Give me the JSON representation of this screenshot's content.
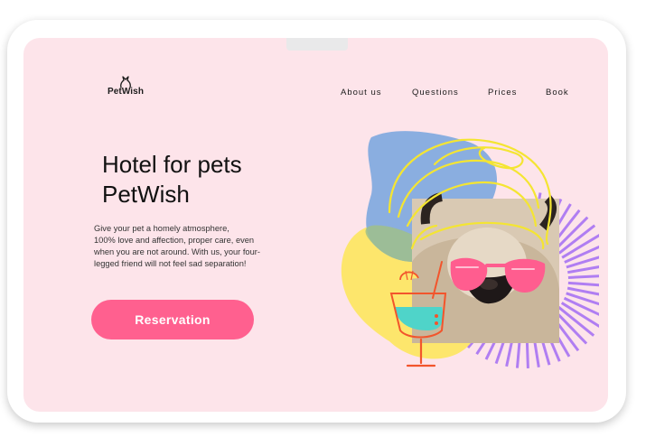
{
  "brand": {
    "name": "PetWish"
  },
  "nav": {
    "items": [
      "About us",
      "Questions",
      "Prices",
      "Book"
    ]
  },
  "hero": {
    "title_lines": [
      "Hotel for pets",
      "PetWish"
    ],
    "description_lines": [
      "Give your pet a homely atmosphere,",
      "100% love and affection, proper care, even",
      "when you are not around. With us, your four-",
      "legged friend will not feel sad separation!"
    ],
    "button_label": "Reservation"
  },
  "colors": {
    "background": "#fde4ea",
    "accent": "#ff608f",
    "blob_blue": "#8aaee0",
    "blob_yellow": "#fde66c",
    "stripes_purple": "#b07ef2",
    "scribble_yellow": "#f4e532",
    "glasses_pink": "#ff5d8f",
    "drink_teal": "#4fd4c9",
    "drink_orange": "#f2552c"
  },
  "illustration": {
    "icons": [
      "pug-photo",
      "turban-scribble",
      "sunglasses",
      "cocktail-glass",
      "sunburst-stripes"
    ]
  }
}
